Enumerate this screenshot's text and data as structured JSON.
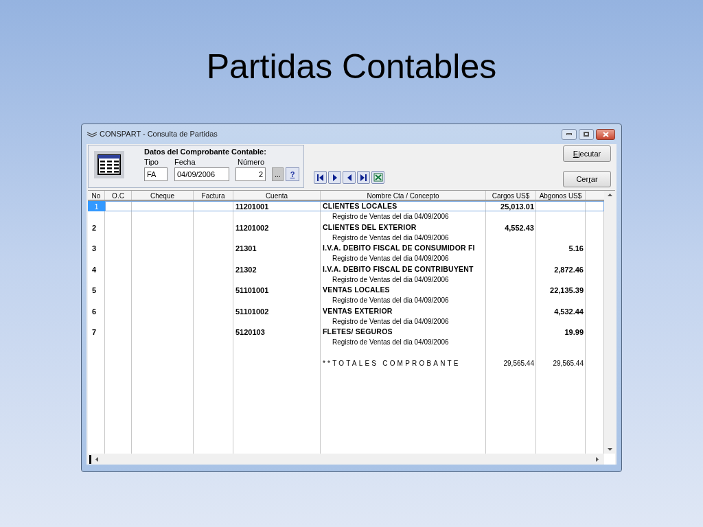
{
  "slide_title": "Partidas Contables",
  "window": {
    "title": "CONSPART - Consulta de Partidas"
  },
  "voucher": {
    "heading": "Datos del Comprobante Contable:",
    "fields": [
      {
        "label": "Tipo",
        "value": "FA",
        "kind": "left"
      },
      {
        "label": "Fecha",
        "value": "04/09/2006",
        "kind": "left"
      },
      {
        "label": "Número",
        "value": "2",
        "kind": "right"
      }
    ],
    "browse_button": "...",
    "help_button": "?"
  },
  "buttons": [
    {
      "key": "E",
      "after": "jecutar"
    },
    {
      "before": "Cer",
      "key": "r",
      "after": "ar"
    }
  ],
  "grid": {
    "columns": [
      "No",
      "O.C",
      "Cheque",
      "Factura",
      "Cuenta",
      "Nombre Cta / Concepto",
      "Cargos US$",
      "Abgonos US$"
    ],
    "rows": [
      {
        "no": "1",
        "cuenta": "11201001",
        "nombre": "CLIENTES LOCALES",
        "cargos": "25,013.01",
        "concepto": "Registro de Ventas del dia 04/09/2006",
        "selected": true
      },
      {
        "no": "2",
        "cuenta": "11201002",
        "nombre": "CLIENTES DEL EXTERIOR",
        "cargos": "4,552.43",
        "concepto": "Registro de Ventas del dia 04/09/2006",
        "selected": false
      },
      {
        "no": "3",
        "cuenta": "21301",
        "nombre": "I.V.A. DEBITO FISCAL DE CONSUMIDOR FI",
        "abonos": "5.16",
        "concepto": "Registro de Ventas del dia 04/09/2006",
        "selected": false
      },
      {
        "no": "4",
        "cuenta": "21302",
        "nombre": "I.V.A. DEBITO FISCAL DE CONTRIBUYENT",
        "abonos": "2,872.46",
        "concepto": "Registro de Ventas del dia 04/09/2006",
        "selected": false
      },
      {
        "no": "5",
        "cuenta": "51101001",
        "nombre": "VENTAS LOCALES",
        "abonos": "22,135.39",
        "concepto": "Registro de Ventas del dia 04/09/2006",
        "selected": false
      },
      {
        "no": "6",
        "cuenta": "51101002",
        "nombre": "VENTAS EXTERIOR",
        "abonos": "4,532.44",
        "concepto": "Registro de Ventas del dia 04/09/2006",
        "selected": false
      },
      {
        "no": "7",
        "cuenta": "5120103",
        "nombre": "FLETES/ SEGUROS",
        "abonos": "19.99",
        "concepto": "Registro de Ventas del dia 04/09/2006",
        "selected": false
      }
    ],
    "totals": {
      "label": "**TOTALES COMPROBANTE",
      "cargos": "29,565.44",
      "abonos": "29,565.44"
    }
  }
}
